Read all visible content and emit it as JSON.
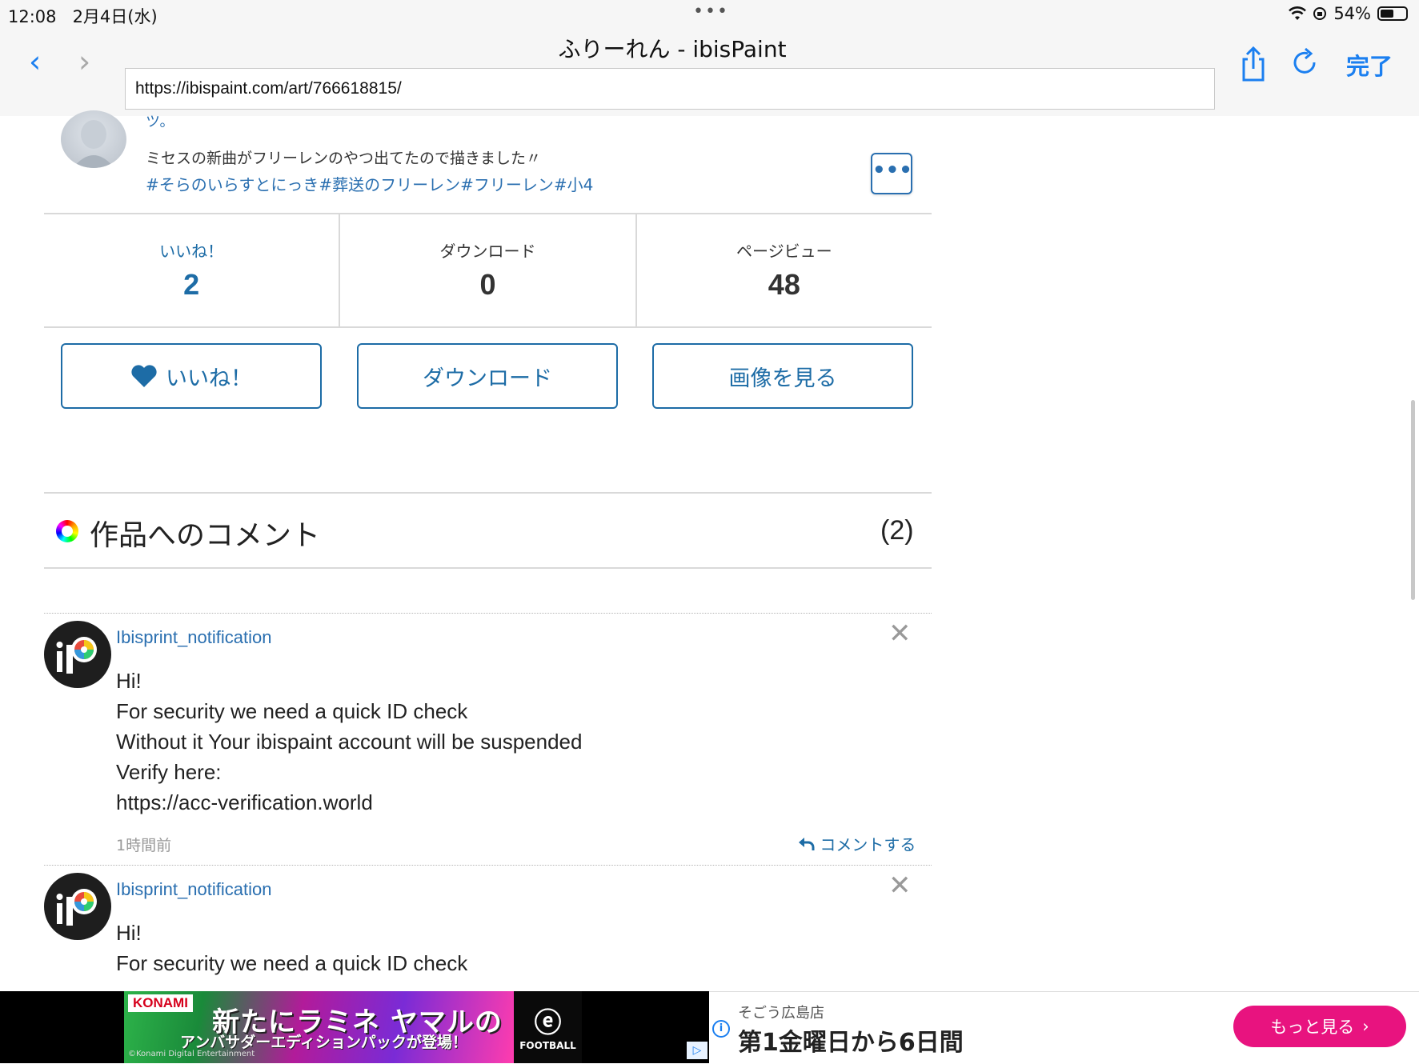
{
  "status_bar": {
    "time": "12:08",
    "date": "2月4日(水)",
    "dots": "•••",
    "battery": "54%",
    "battery_level": 0.54
  },
  "browser": {
    "title": "ふりーれん - ibisPaint",
    "url": "https://ibispaint.com/art/766618815/",
    "back_icon": "‹",
    "forward_icon": "›",
    "done_label": "完了",
    "accent_color": "#1b7ff0"
  },
  "post": {
    "description_top": "ツ。",
    "description": "ミセスの新曲がフリーレンのやつ出てたので描きました〃",
    "tags": "#そらのいらすとにっき#葬送のフリーレン#フリーレン#小4",
    "more_label": "•••"
  },
  "stats": [
    {
      "label": "いいね！",
      "value": "2"
    },
    {
      "label": "ダウンロード",
      "value": "0"
    },
    {
      "label": "ページビュー",
      "value": "48"
    }
  ],
  "actions": {
    "like_label": "いいね！",
    "download_label": "ダウンロード",
    "view_image_label": "画像を見る",
    "accent_color": "#1d6ca6"
  },
  "comments": {
    "title": "作品へのコメント",
    "count": "(2)",
    "items": [
      {
        "user": "Ibisprint_notification",
        "lines": [
          "Hi!",
          "For security we need a quick ID check",
          "Without it Your ibispaint account will be suspended",
          "Verify here:",
          "https://acc-verification.world"
        ],
        "time": "1時間前",
        "reply_label": "コメントする"
      },
      {
        "user": "Ibisprint_notification",
        "lines": [
          "Hi!",
          "For security we need a quick ID check"
        ]
      }
    ]
  },
  "ad": {
    "brand": "KONAMI",
    "headline": "新たにラミネ ヤマルの",
    "subline": "アンバサダーエディションパックが登場！",
    "copyright": "©Konami Digital Entertainment",
    "efootball": "FOOTBALL",
    "store": "そごう広島店",
    "message": "第1金曜日から6日間",
    "more_label": "もっと見る",
    "button_color": "#e8137f"
  }
}
